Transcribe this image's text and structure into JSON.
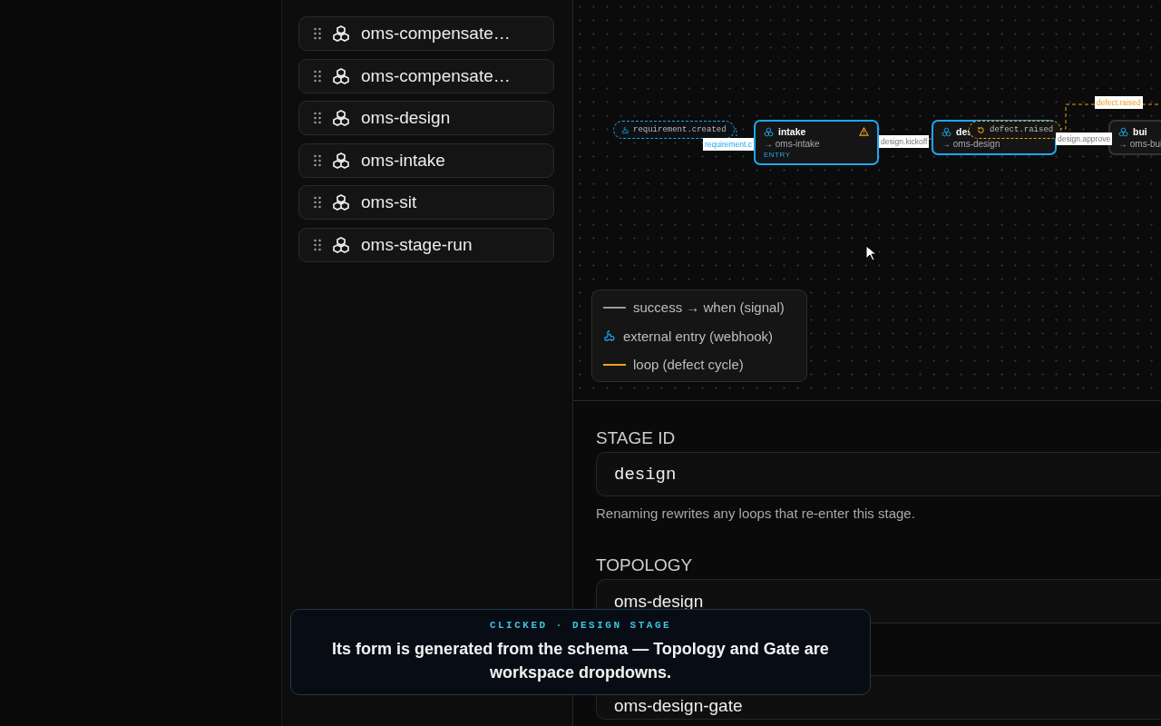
{
  "sidebar": {
    "items": [
      {
        "label": "oms-compensate…"
      },
      {
        "label": "oms-compensate…"
      },
      {
        "label": "oms-design"
      },
      {
        "label": "oms-intake"
      },
      {
        "label": "oms-sit"
      },
      {
        "label": "oms-stage-run"
      }
    ]
  },
  "canvas": {
    "nodes": [
      {
        "kind": "trigger",
        "label": "requirement.created"
      },
      {
        "kind": "stage",
        "title": "intake",
        "topology": "→ oms-intake",
        "badge": "ENTRY",
        "warning": true,
        "selected": true
      },
      {
        "kind": "stage",
        "title": "des",
        "topology": "→ oms-design",
        "loop_pill": "defect.raised",
        "selected": true
      },
      {
        "kind": "stage",
        "title": "bui",
        "topology": "→ oms-bui",
        "selected": false
      }
    ],
    "edge_labels": [
      {
        "kind": "webhook",
        "label": "requirement.c"
      },
      {
        "kind": "success",
        "label": "design.kickoff"
      },
      {
        "kind": "success",
        "label": "design.approve"
      },
      {
        "kind": "loop",
        "label": "defect.raised"
      }
    ],
    "legend": [
      {
        "kind": "success",
        "label": "success → when (signal)"
      },
      {
        "kind": "webhook",
        "label": "external entry (webhook)"
      },
      {
        "kind": "loop",
        "label": "loop (defect cycle)"
      }
    ]
  },
  "form": {
    "fields": [
      {
        "kind": "text",
        "label": "STAGE ID",
        "value": "design",
        "hint": "Renaming rewrites any loops that re-enter this stage."
      },
      {
        "kind": "select",
        "label": "TOPOLOGY",
        "value": "oms-design"
      },
      {
        "kind": "select",
        "value": "oms-design-gate"
      }
    ]
  },
  "callout": {
    "eyebrow": "CLICKED · DESIGN STAGE",
    "text": "Its form is generated from the schema — Topology and Gate are workspace dropdowns."
  }
}
